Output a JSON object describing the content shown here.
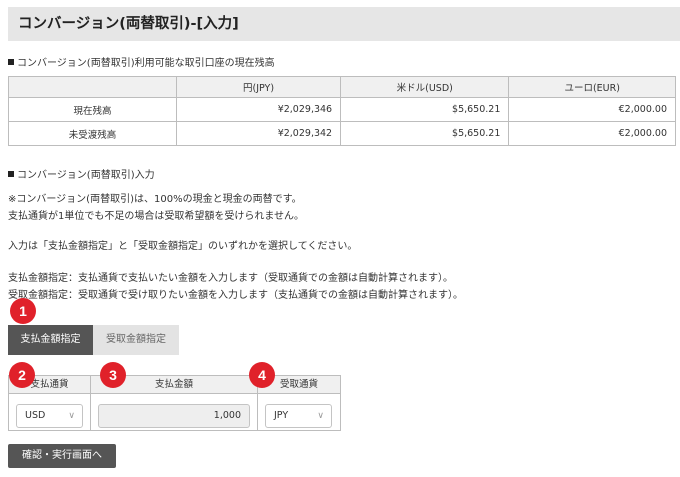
{
  "page": {
    "title": "コンバージョン(両替取引)-[入力]"
  },
  "balance_section": {
    "heading": "コンバージョン(両替取引)利用可能な取引口座の現在残高",
    "columns": [
      "",
      "円(JPY)",
      "米ドル(USD)",
      "ユーロ(EUR)"
    ],
    "rows": [
      {
        "label": "現在残高",
        "jpy": "¥2,029,346",
        "usd": "$5,650.21",
        "eur": "€2,000.00"
      },
      {
        "label": "未受渡残高",
        "jpy": "¥2,029,342",
        "usd": "$5,650.21",
        "eur": "€2,000.00"
      }
    ]
  },
  "input_section": {
    "heading": "コンバージョン(両替取引)入力",
    "notes": [
      "※コンバージョン(両替取引)は、100%の現金と現金の両替です。",
      "支払通貨が1単位でも不足の場合は受取希望額を受けられません。",
      "入力は「支払金額指定」と「受取金額指定」のいずれかを選択してください。",
      "支払金額指定：支払通貨で支払いたい金額を入力します（受取通貨での金額は自動計算されます）。",
      "受取金額指定：受取通貨で受け取りたい金額を入力します（支払通貨での金額は自動計算されます）。"
    ]
  },
  "tabs": {
    "pay_amount": "支払金額指定",
    "receive_amount": "受取金額指定"
  },
  "form": {
    "pay_currency_header": "支払通貨",
    "pay_amount_header": "支払金額",
    "receive_currency_header": "受取通貨",
    "pay_currency_value": "USD",
    "pay_amount_value": "1,000",
    "receive_currency_value": "JPY"
  },
  "badges": [
    "1",
    "2",
    "3",
    "4"
  ],
  "confirm_button": "確認・実行画面へ",
  "colors": {
    "badge": "#e0212a",
    "active_tab": "#555555",
    "inactive_tab": "#e3e3e3",
    "title_bar": "#e6e6e6"
  }
}
